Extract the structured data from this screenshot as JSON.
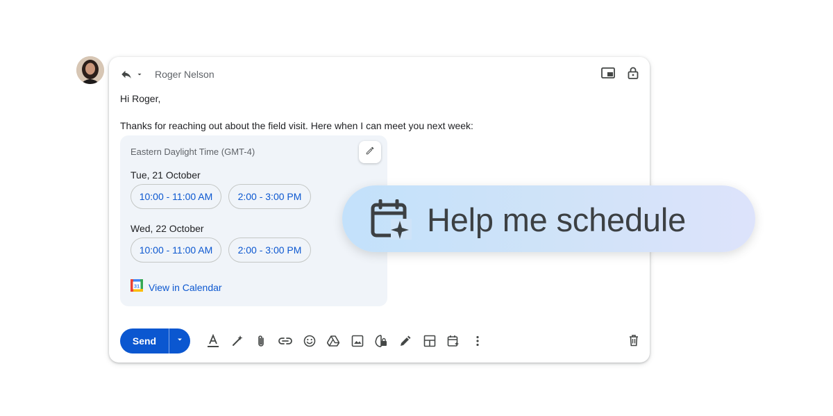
{
  "compose": {
    "recipient": "Roger Nelson",
    "greeting": "Hi Roger,",
    "message": "Thanks for reaching out about the field visit. Here when I can meet you next week:"
  },
  "scheduler": {
    "timezone": "Eastern Daylight Time (GMT-4)",
    "days": [
      {
        "label": "Tue, 21 October",
        "slots": [
          "10:00 - 11:00 AM",
          "2:00 - 3:00 PM"
        ]
      },
      {
        "label": "Wed, 22 October",
        "slots": [
          "10:00 - 11:00 AM",
          "2:00 - 3:00 PM"
        ]
      }
    ],
    "calendar_link": "View in Calendar",
    "calendar_badge": "31"
  },
  "toolbar": {
    "send_label": "Send",
    "icons": [
      "format-text-icon",
      "help-me-write-icon",
      "attach-icon",
      "link-icon",
      "emoji-icon",
      "drive-icon",
      "photo-icon",
      "confidential-icon",
      "signature-icon",
      "layout-icon",
      "schedule-icon",
      "more-icon",
      "trash-icon"
    ]
  },
  "feature": {
    "label": "Help me schedule"
  },
  "colors": {
    "accent": "#0b57d0",
    "card_bg": "#f0f4f9",
    "pill_gradient": [
      "#c3e1fb",
      "#dde3fb"
    ]
  }
}
